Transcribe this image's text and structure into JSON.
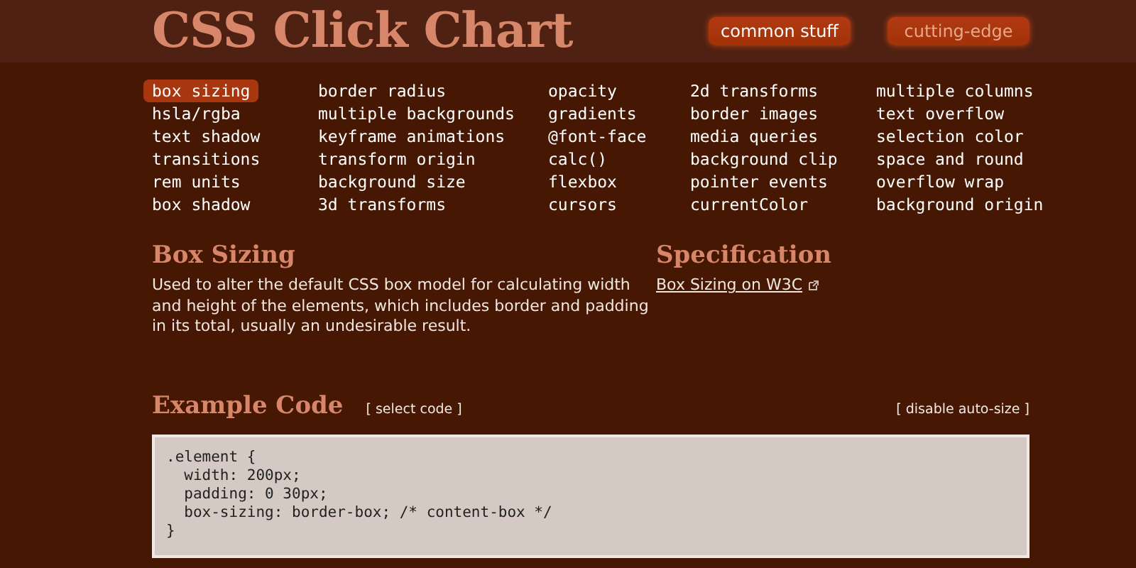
{
  "header": {
    "title": "CSS Click Chart",
    "nav": [
      {
        "label": "common stuff",
        "selected": true
      },
      {
        "label": "cutting-edge",
        "selected": false
      }
    ]
  },
  "properties": [
    [
      {
        "label": "box sizing",
        "selected": true
      },
      {
        "label": "hsla/rgba",
        "selected": false
      },
      {
        "label": "text shadow",
        "selected": false
      },
      {
        "label": "transitions",
        "selected": false
      },
      {
        "label": "rem units",
        "selected": false
      },
      {
        "label": "box shadow",
        "selected": false
      }
    ],
    [
      {
        "label": "border radius",
        "selected": false
      },
      {
        "label": "multiple backgrounds",
        "selected": false
      },
      {
        "label": "keyframe animations",
        "selected": false
      },
      {
        "label": "transform origin",
        "selected": false
      },
      {
        "label": "background size",
        "selected": false
      },
      {
        "label": "3d transforms",
        "selected": false
      }
    ],
    [
      {
        "label": "opacity",
        "selected": false
      },
      {
        "label": "gradients",
        "selected": false
      },
      {
        "label": "@font-face",
        "selected": false
      },
      {
        "label": "calc()",
        "selected": false
      },
      {
        "label": "flexbox",
        "selected": false
      },
      {
        "label": "cursors",
        "selected": false
      }
    ],
    [
      {
        "label": "2d transforms",
        "selected": false
      },
      {
        "label": "border images",
        "selected": false
      },
      {
        "label": "media queries",
        "selected": false
      },
      {
        "label": "background clip",
        "selected": false
      },
      {
        "label": "pointer events",
        "selected": false
      },
      {
        "label": "currentColor",
        "selected": false
      }
    ],
    [
      {
        "label": "multiple columns",
        "selected": false
      },
      {
        "label": "text overflow",
        "selected": false
      },
      {
        "label": "selection color",
        "selected": false
      },
      {
        "label": "space and round",
        "selected": false
      },
      {
        "label": "overflow wrap",
        "selected": false
      },
      {
        "label": "background origin",
        "selected": false
      }
    ]
  ],
  "detail": {
    "title": "Box Sizing",
    "description": "Used to alter the default CSS box model for calculating width and height of the elements, which includes border and padding in its total, usually an undesirable result."
  },
  "specification": {
    "title": "Specification",
    "link": "Box Sizing on W3C"
  },
  "example": {
    "title": "Example Code",
    "select_action": "[ select code ]",
    "autosize_action": "[ disable auto-size ]",
    "code": [
      ".element {",
      "  width: 200px;",
      "  padding: 0 30px;",
      "  box-sizing: border-box; /* content-box */",
      "}"
    ]
  }
}
